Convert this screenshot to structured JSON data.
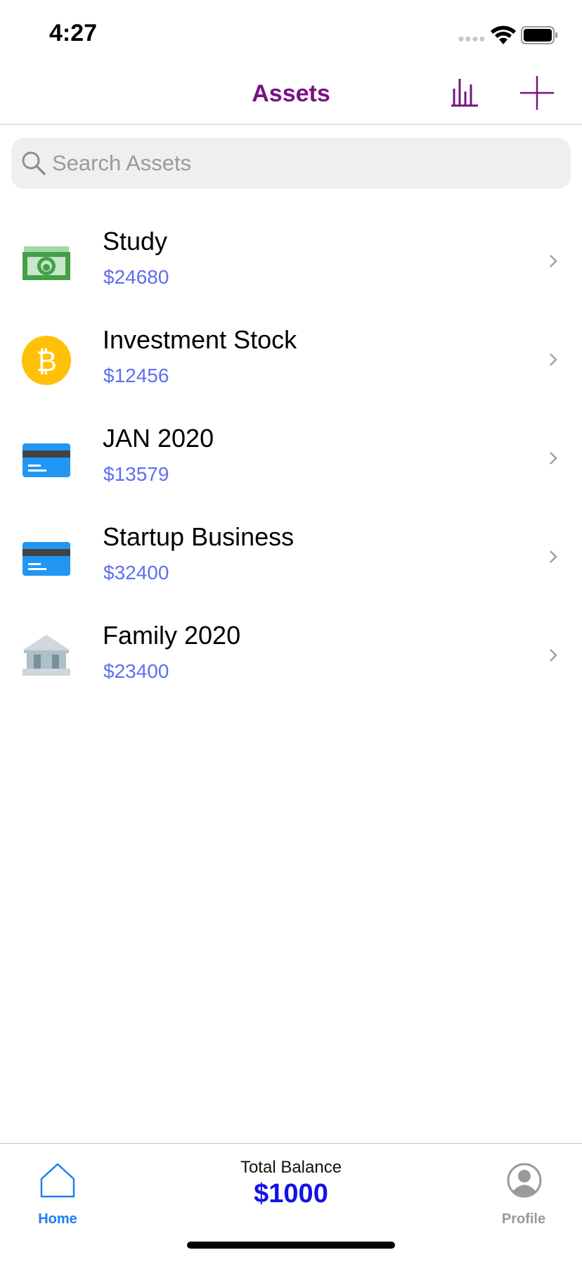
{
  "status_bar": {
    "time": "4:27"
  },
  "nav": {
    "title": "Assets",
    "title_color": "#7a1184",
    "chart_icon": "bar-chart-icon",
    "add_icon": "plus-icon"
  },
  "search": {
    "placeholder": "Search Assets",
    "value": ""
  },
  "assets": [
    {
      "name": "Study",
      "amount": "$24680",
      "icon": "cash-icon"
    },
    {
      "name": "Investment Stock",
      "amount": "$12456",
      "icon": "bitcoin-icon"
    },
    {
      "name": "JAN 2020",
      "amount": "$13579",
      "icon": "credit-card-icon"
    },
    {
      "name": "Startup Business",
      "amount": "$32400",
      "icon": "credit-card-icon"
    },
    {
      "name": "Family 2020",
      "amount": "$23400",
      "icon": "bank-icon"
    }
  ],
  "tabbar": {
    "home_label": "Home",
    "balance_label": "Total Balance",
    "balance_value": "$1000",
    "profile_label": "Profile",
    "active_color": "#1a7ef5",
    "inactive_color": "#9a9a9e",
    "balance_color": "#1212e6"
  },
  "colors": {
    "amount": "#5d6ff0"
  }
}
